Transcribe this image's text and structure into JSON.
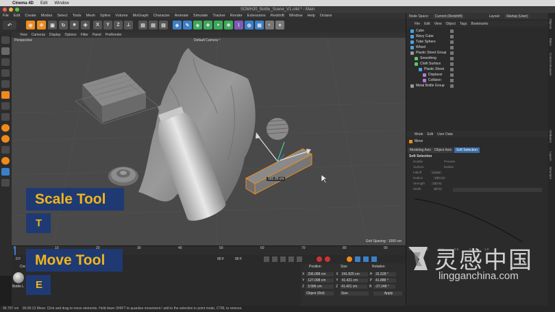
{
  "os_menu": {
    "app": "Cinema 4D",
    "items": [
      "Edit",
      "Window"
    ]
  },
  "window": {
    "title": "SOMH20_Bottle_Scene_V1.c4d * - Main"
  },
  "main_menu": [
    "File",
    "Edit",
    "Create",
    "Modes",
    "Select",
    "Tools",
    "Mesh",
    "Spline",
    "Volume",
    "MoGraph",
    "Character",
    "Animate",
    "Simulate",
    "Tracker",
    "Render",
    "Extensions",
    "Redshift",
    "Window",
    "Help",
    "Octane"
  ],
  "toolbar": {
    "x_label": "X",
    "y_label": "Y",
    "z_label": "Z"
  },
  "viewport_menu": [
    "View",
    "Cameras",
    "Display",
    "Options",
    "Filter",
    "Panel",
    "ProRender"
  ],
  "viewport": {
    "name": "Perspective",
    "camera": "Default Camera ⁰",
    "grid_spacing": "Grid Spacing : 1000 cm",
    "dimension_label": "182.39 cm"
  },
  "timeline": {
    "ticks": [
      "0",
      "10",
      "20",
      "30",
      "40",
      "50",
      "60",
      "70",
      "80",
      "90"
    ],
    "frame_left": "0 F",
    "frame_mid": "90 F",
    "frame_right": "90 F"
  },
  "overlays": [
    {
      "title": "Scale Tool",
      "key": "T"
    },
    {
      "title": "Move Tool",
      "key": "E"
    }
  ],
  "material_panel": {
    "menu": "Cre",
    "mat_label": "Bottle L"
  },
  "coordinates": {
    "headers": [
      "Position",
      "Size",
      "Rotation"
    ],
    "rows": [
      {
        "axis": "X",
        "pos": "296.088 cm",
        "size_axis": "X",
        "size": "241.825 cm",
        "rot_axis": "H",
        "rot": "31.528 °"
      },
      {
        "axis": "Y",
        "pos": "127.098 cm",
        "size_axis": "Y",
        "size": "41.421 cm",
        "rot_axis": "P",
        "rot": "41.888 °"
      },
      {
        "axis": "Z",
        "pos": "3.586 cm",
        "size_axis": "Z",
        "size": "41.421 cm",
        "rot_axis": "B",
        "rot": "-27.248 °"
      }
    ],
    "mode_select": "Object (Rel)",
    "size_select": "Size",
    "apply_label": "Apply"
  },
  "status": {
    "text": "00:00:13  Move: Click and drag to move elements. Hold down SHIFT to quantize movement / add to the selection in point mode, CTRL to remove.",
    "coord": "95.707 cm"
  },
  "object_manager": {
    "node_space_label": "Node Space:",
    "node_space_value": "Current (Redshift)",
    "layout_label": "Layout:",
    "layout_value": "Startup (User)",
    "menu": [
      "File",
      "Edit",
      "View",
      "Object",
      "Tags",
      "Bookmarks"
    ],
    "objects": [
      {
        "name": "Cube",
        "color": "#4aa3e0",
        "indent": 0
      },
      {
        "name": "Wavy Cube",
        "color": "#4aa3e0",
        "indent": 0
      },
      {
        "name": "Tube Sphere",
        "color": "#4aa3e0",
        "indent": 0
      },
      {
        "name": "Wheel",
        "color": "#4aa3e0",
        "indent": 0
      },
      {
        "name": "Plastic Sheet Group",
        "color": "#9a9a9a",
        "indent": 0
      },
      {
        "name": "Smoothing",
        "color": "#61c46b",
        "indent": 1
      },
      {
        "name": "Cloth Surface",
        "color": "#61c46b",
        "indent": 1
      },
      {
        "name": "Plastic Sheet",
        "color": "#4aa3e0",
        "indent": 2
      },
      {
        "name": "Displacer",
        "color": "#b07ad8",
        "indent": 3
      },
      {
        "name": "Collision",
        "color": "#b07ad8",
        "indent": 3
      },
      {
        "name": "Metal Bottle Group",
        "color": "#9a9a9a",
        "indent": 0
      }
    ]
  },
  "attributes": {
    "menu": [
      "Mode",
      "Edit",
      "User Data"
    ],
    "title": "Move",
    "tabs": [
      "Modeling Axis",
      "Object Axis",
      "Soft Selection"
    ],
    "section": "Soft Selection",
    "params": [
      {
        "label": "Enable",
        "value": "Preview"
      },
      {
        "label": "Surface",
        "value": "Rubber"
      },
      {
        "label": "Falloff",
        "value": "Linear"
      },
      {
        "label": "Radius",
        "value": "100 cm"
      },
      {
        "label": "Strength",
        "value": "100 %"
      },
      {
        "label": "Width",
        "value": "50 %"
      }
    ],
    "graph_ticks": [
      "0.0",
      "0.2",
      "0.4",
      "0.6",
      "0.8",
      "1.0"
    ]
  },
  "right_strip_tabs": [
    "Objects",
    "Takes",
    "Content Browser",
    "Attributes",
    "Layers",
    "Structure"
  ],
  "watermark": {
    "cn": "灵感中国",
    "url": "lingganchina.com"
  },
  "colors": {
    "accent": "#f08a1c",
    "overlay_bg": "#1f3a73",
    "overlay_text": "#f2b51a",
    "panel": "#2b2b2b",
    "viewport": "#494949"
  }
}
